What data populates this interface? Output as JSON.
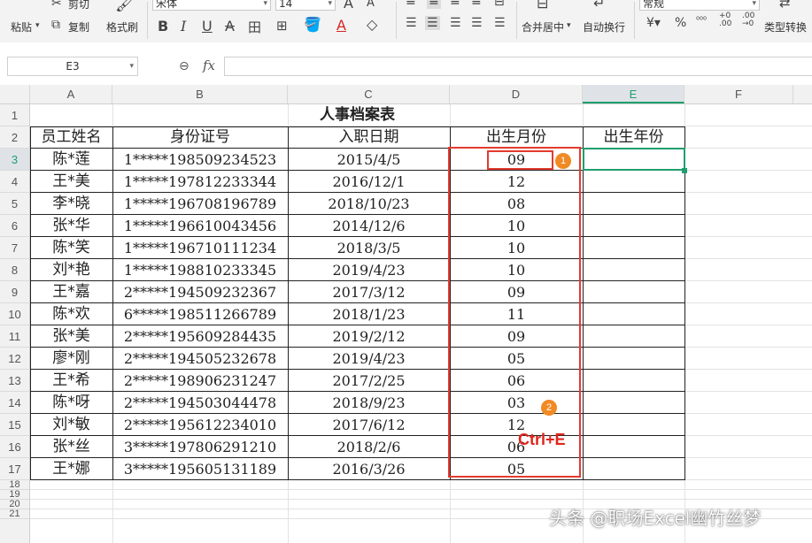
{
  "ribbon": {
    "paste": "粘贴",
    "cut": "剪切",
    "copy": "复制",
    "format_painter": "格式刷",
    "font_name": "宋体",
    "font_size": "14",
    "merge_center": "合并居中",
    "wrap_text": "自动换行",
    "number_format": "常规",
    "type_convert": "类型转换",
    "icons": [
      "scissors-icon",
      "copy-icon",
      "format-painter-icon",
      "bold-icon",
      "italic-icon",
      "underline-icon",
      "strikethrough-icon",
      "border-icon",
      "fill-color-icon",
      "font-color-icon",
      "eraser-icon",
      "align-icon",
      "currency-icon",
      "percent-icon",
      "decimal-icon"
    ]
  },
  "formula_bar": {
    "name_box": "E3",
    "fx": "fx",
    "content": ""
  },
  "columns": [
    "A",
    "B",
    "C",
    "D",
    "E",
    "F"
  ],
  "active_cell": {
    "column": "E",
    "row": "3"
  },
  "rows": [
    "1",
    "2",
    "3",
    "4",
    "5",
    "6",
    "7",
    "8",
    "9",
    "10",
    "11",
    "12",
    "13",
    "14",
    "15",
    "16",
    "17",
    "18",
    "19",
    "20",
    "21"
  ],
  "table": {
    "title": "人事档案表",
    "headers": [
      "员工姓名",
      "身份证号",
      "入职日期",
      "出生月份",
      "出生年份"
    ],
    "records": [
      {
        "name": "陈*莲",
        "id": "1*****198509234523",
        "date": "2015/4/5",
        "month": "09"
      },
      {
        "name": "王*美",
        "id": "1*****197812233344",
        "date": "2016/12/1",
        "month": "12"
      },
      {
        "name": "李*晓",
        "id": "1*****196708196789",
        "date": "2018/10/23",
        "month": "08"
      },
      {
        "name": "张*华",
        "id": "1*****196610043456",
        "date": "2014/12/6",
        "month": "10"
      },
      {
        "name": "陈*笑",
        "id": "1*****196710111234",
        "date": "2018/3/5",
        "month": "10"
      },
      {
        "name": "刘*艳",
        "id": "1*****198810233345",
        "date": "2019/4/23",
        "month": "10"
      },
      {
        "name": "王*嘉",
        "id": "2*****194509232367",
        "date": "2017/3/12",
        "month": "09"
      },
      {
        "name": "陈*欢",
        "id": "6*****198511266789",
        "date": "2018/1/23",
        "month": "11"
      },
      {
        "name": "张*美",
        "id": "2*****195609284435",
        "date": "2019/2/12",
        "month": "09"
      },
      {
        "name": "廖*刚",
        "id": "2*****194505232678",
        "date": "2019/4/23",
        "month": "05"
      },
      {
        "name": "王*希",
        "id": "2*****198906231247",
        "date": "2017/2/25",
        "month": "06"
      },
      {
        "name": "陈*呀",
        "id": "2*****194503044478",
        "date": "2018/9/23",
        "month": "03"
      },
      {
        "name": "刘*敏",
        "id": "2*****195612234010",
        "date": "2017/6/12",
        "month": "12"
      },
      {
        "name": "张*丝",
        "id": "3*****197806291210",
        "date": "2018/2/6",
        "month": "06"
      },
      {
        "name": "王*娜",
        "id": "3*****195605131189",
        "date": "2016/3/26",
        "month": "05"
      }
    ]
  },
  "annotations": {
    "badge1": "1",
    "badge2": "2",
    "shortcut": "Ctrl+E",
    "highlight_color": "#e33b2f",
    "badge_color": "#f08a24"
  },
  "watermark": "头条 @职场Excel幽竹丝梦",
  "colors": {
    "selection": "#1f9e6d"
  }
}
